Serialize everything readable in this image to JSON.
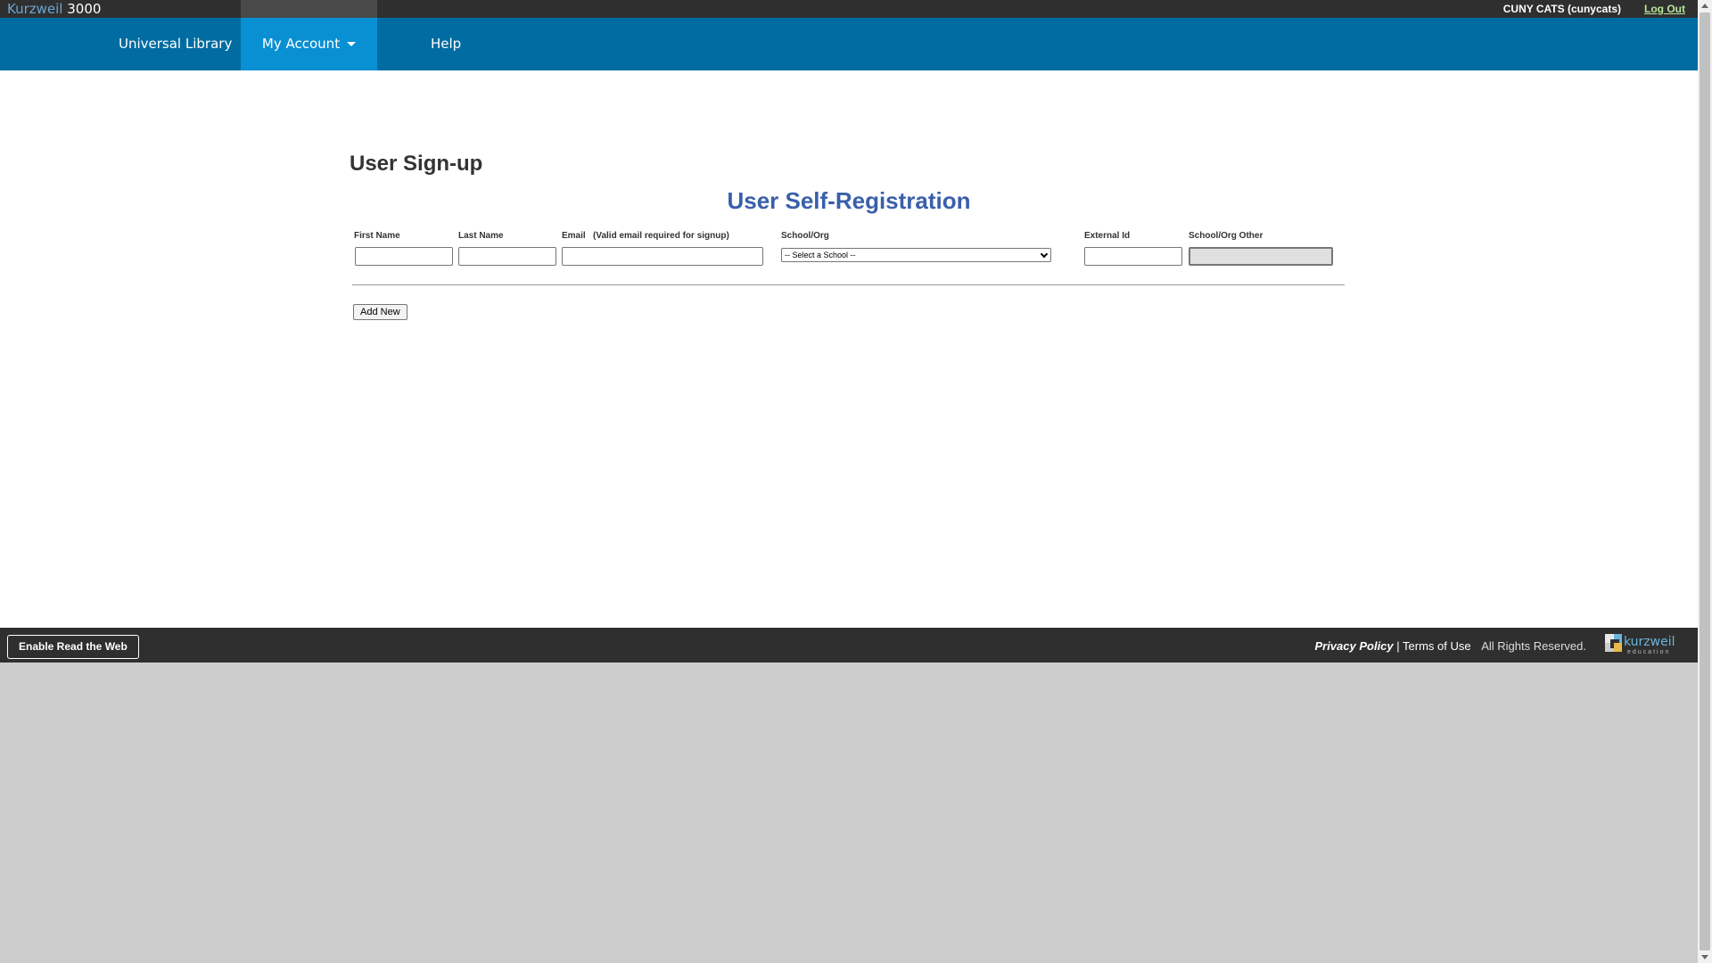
{
  "header": {
    "brand_name": "Kurzweil",
    "brand_number": "3000",
    "user_label": "CUNY CATS (cunycats)",
    "logout_label": "Log Out"
  },
  "nav": {
    "items": [
      {
        "label": "Universal Library"
      },
      {
        "label": "My Account"
      },
      {
        "label": "Help"
      }
    ]
  },
  "main": {
    "page_title": "User Sign-up",
    "form_title": "User Self-Registration",
    "fields": {
      "first_name": {
        "label": "First Name",
        "value": ""
      },
      "last_name": {
        "label": "Last Name",
        "value": ""
      },
      "email": {
        "label": "Email   (Valid email required for signup)",
        "value": ""
      },
      "school": {
        "label": "School/Org",
        "selected": "-- Select a School --"
      },
      "external_id": {
        "label": "External Id",
        "value": ""
      },
      "school_other": {
        "label": "School/Org Other",
        "value": ""
      }
    },
    "add_button_label": "Add New"
  },
  "footer": {
    "read_the_web_label": "Enable Read the Web",
    "privacy_label": "Privacy Policy",
    "separator": " | ",
    "terms_label": "Terms of Use",
    "rights_label": "All Rights Reserved.",
    "logo_text": "kurzweil",
    "logo_sub": "education"
  },
  "colors": {
    "topbar": "#2f2f2f",
    "nav": "#006ca2",
    "nav_active": "#0990d2",
    "form_title": "#3a5faa",
    "logout_link": "#b9e39a"
  }
}
